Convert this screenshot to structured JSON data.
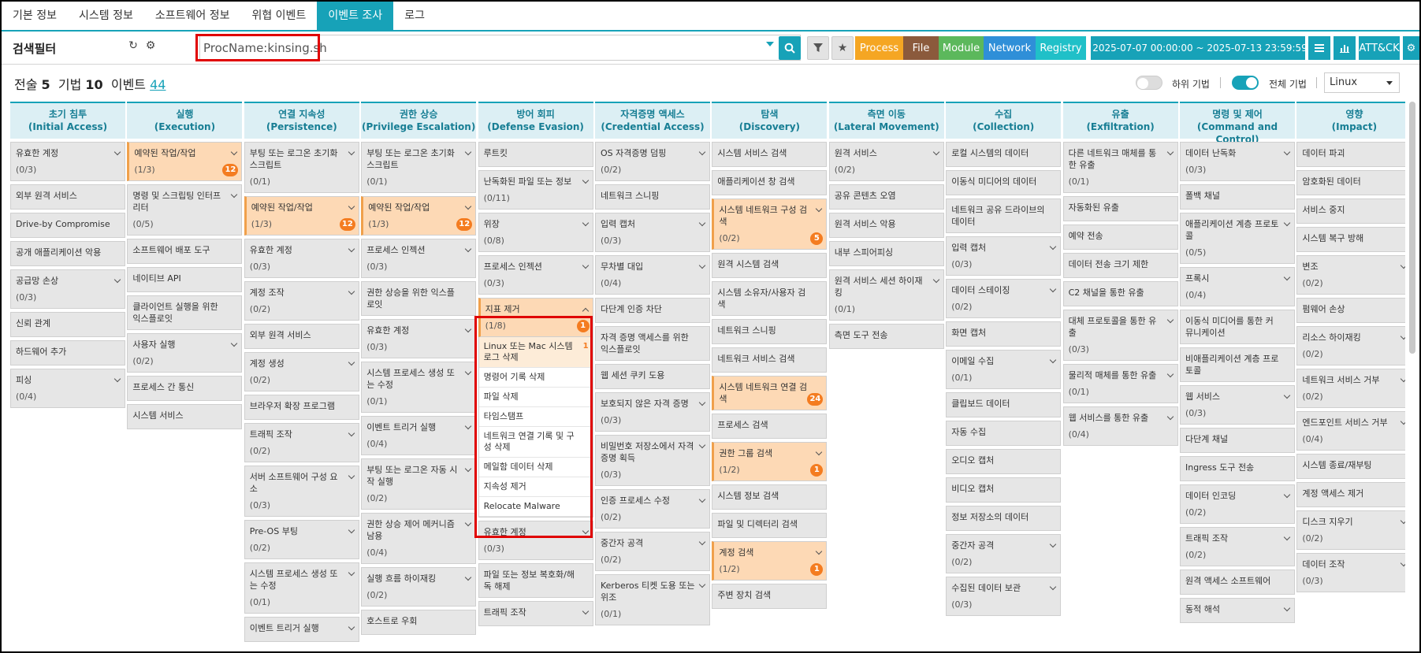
{
  "tabs": [
    {
      "label": "기본 정보",
      "active": false
    },
    {
      "label": "시스템 정보",
      "active": false
    },
    {
      "label": "소프트웨어 정보",
      "active": false
    },
    {
      "label": "위협 이벤트",
      "active": false
    },
    {
      "label": "이벤트 조사",
      "active": true
    },
    {
      "label": "로그",
      "active": false
    }
  ],
  "filter": {
    "title": "검색필터",
    "refresh_icon": "refresh-icon",
    "settings_icon": "gear-icon",
    "search_value": "ProcName:kinsing.sh",
    "search_icon": "search-icon",
    "funnel_icon": "funnel-icon",
    "star_icon": "star-icon",
    "categories": [
      {
        "label": "Process",
        "color": "#f5a623"
      },
      {
        "label": "File",
        "color": "#8b5a3c"
      },
      {
        "label": "Module",
        "color": "#5cb85c"
      },
      {
        "label": "Network",
        "color": "#2f8fd8"
      },
      {
        "label": "Registry",
        "color": "#20c0c8"
      }
    ],
    "date_range": "2025-07-07 00:00:00 ~ 2025-07-13 23:59:59",
    "calendar_icon": "calendar-icon",
    "list_icon": "list-icon",
    "chart_icon": "bar-chart-icon",
    "attck_label": "ATT&CK"
  },
  "summary": {
    "tactic_label": "전술",
    "tactic_count": "5",
    "technique_label": "기법",
    "technique_count": "10",
    "event_label": "이벤트",
    "event_count": "44"
  },
  "toggles": {
    "sub_technique_label": "하위 기법",
    "all_technique_label": "전체 기법"
  },
  "os_select": "Linux",
  "colors": {
    "accent": "#17a2b8",
    "highlight": "#fdd9b5",
    "badge": "#f47c20"
  },
  "matrix": [
    {
      "title": "초기 침투",
      "subtitle": "(Initial Access)",
      "techniques": [
        {
          "name": "유효한 계정",
          "count": "(0/3)",
          "expand": true
        },
        {
          "name": "외부 원격 서비스"
        },
        {
          "name": "Drive-by Compromise"
        },
        {
          "name": "공개 애플리케이션 악용"
        },
        {
          "name": "공급망 손상",
          "count": "(0/3)",
          "expand": true
        },
        {
          "name": "신뢰 관계"
        },
        {
          "name": "하드웨어 추가"
        },
        {
          "name": "피싱",
          "count": "(0/4)",
          "expand": true
        }
      ]
    },
    {
      "title": "실행",
      "subtitle": "(Execution)",
      "techniques": [
        {
          "name": "예약된 작업/작업",
          "count": "(1/3)",
          "expand": true,
          "hl": true,
          "badge": "12"
        },
        {
          "name": "명령 및 스크립팅 인터프리터",
          "count": "(0/5)",
          "expand": true
        },
        {
          "name": "소프트웨어 배포 도구"
        },
        {
          "name": "네이티브 API"
        },
        {
          "name": "클라이언트 실행을 위한 익스플로잇"
        },
        {
          "name": "사용자 실행",
          "count": "(0/2)",
          "expand": true
        },
        {
          "name": "프로세스 간 통신"
        },
        {
          "name": "시스템 서비스"
        }
      ]
    },
    {
      "title": "연결 지속성",
      "subtitle": "(Persistence)",
      "techniques": [
        {
          "name": "부팅 또는 로그온 초기화 스크립트",
          "count": "(0/1)",
          "expand": true
        },
        {
          "name": "예약된 작업/작업",
          "count": "(1/3)",
          "expand": true,
          "hl": true,
          "badge": "12"
        },
        {
          "name": "유효한 계정",
          "count": "(0/3)",
          "expand": true
        },
        {
          "name": "계정 조작",
          "count": "(0/2)",
          "expand": true
        },
        {
          "name": "외부 원격 서비스"
        },
        {
          "name": "계정 생성",
          "count": "(0/2)",
          "expand": true
        },
        {
          "name": "브라우저 확장 프로그램"
        },
        {
          "name": "트래픽 조작",
          "count": "(0/2)",
          "expand": true
        },
        {
          "name": "서버 소프트웨어 구성 요소",
          "count": "(0/3)",
          "expand": true
        },
        {
          "name": "Pre-OS 부팅",
          "count": "(0/2)",
          "expand": true
        },
        {
          "name": "시스템 프로세스 생성 또는 수정",
          "count": "(0/1)",
          "expand": true
        },
        {
          "name": "이벤트 트리거 실행",
          "expand": true
        }
      ]
    },
    {
      "title": "권한 상승",
      "subtitle": "(Privilege Escalation)",
      "techniques": [
        {
          "name": "부팅 또는 로그온 초기화 스크립트",
          "count": "(0/1)",
          "expand": true
        },
        {
          "name": "예약된 작업/작업",
          "count": "(1/3)",
          "expand": true,
          "hl": true,
          "badge": "12"
        },
        {
          "name": "프로세스 인젝션",
          "count": "(0/3)",
          "expand": true
        },
        {
          "name": "권한 상승을 위한 익스플로잇"
        },
        {
          "name": "유효한 계정",
          "count": "(0/3)",
          "expand": true
        },
        {
          "name": "시스템 프로세스 생성 또는 수정",
          "count": "(0/1)",
          "expand": true
        },
        {
          "name": "이벤트 트리거 실행",
          "count": "(0/4)",
          "expand": true
        },
        {
          "name": "부팅 또는 로그온 자동 시작 실행",
          "count": "(0/2)",
          "expand": true
        },
        {
          "name": "권한 상승 제어 메커니즘 남용",
          "count": "(0/4)",
          "expand": true
        },
        {
          "name": "실행 흐름 하이재킹",
          "count": "(0/2)",
          "expand": true
        },
        {
          "name": "호스트로 우회"
        }
      ]
    },
    {
      "title": "방어 회피",
      "subtitle": "(Defense Evasion)",
      "techniques": [
        {
          "name": "루트킷"
        },
        {
          "name": "난독화된 파일 또는 정보",
          "count": "(0/11)",
          "expand": true
        },
        {
          "name": "위장",
          "count": "(0/8)",
          "expand": true
        },
        {
          "name": "프로세스 인젝션",
          "count": "(0/3)",
          "expand": true
        },
        {
          "name": "지표 제거",
          "count": "(1/8)",
          "expanded": true,
          "hl": true,
          "badge": "1",
          "subs": [
            {
              "name": "Linux 또는 Mac 시스템 로그 삭제",
              "num": "1",
              "hl": true
            },
            {
              "name": "명령어 기록 삭제"
            },
            {
              "name": "파일 삭제"
            },
            {
              "name": "타임스탬프"
            },
            {
              "name": "네트워크 연결 기록 및 구성 삭제"
            },
            {
              "name": "메일함 데이터 삭제"
            },
            {
              "name": "지속성 제거"
            },
            {
              "name": "Relocate Malware"
            }
          ]
        },
        {
          "name": "유효한 계정",
          "count": "(0/3)",
          "expand": true
        },
        {
          "name": "파일 또는 정보 복호화/해독 해제"
        },
        {
          "name": "트래픽 조작",
          "expand": true
        }
      ]
    },
    {
      "title": "자격증명 액세스",
      "subtitle": "(Credential Access)",
      "techniques": [
        {
          "name": "OS 자격증명 덤핑",
          "count": "(0/2)",
          "expand": true
        },
        {
          "name": "네트워크 스니핑"
        },
        {
          "name": "입력 캡처",
          "count": "(0/3)",
          "expand": true
        },
        {
          "name": "무차별 대입",
          "count": "(0/4)",
          "expand": true
        },
        {
          "name": "다단계 인증 차단"
        },
        {
          "name": "자격 증명 액세스를 위한 익스플로잇"
        },
        {
          "name": "웹 세션 쿠키 도용"
        },
        {
          "name": "보호되지 않은 자격 증명",
          "count": "(0/3)",
          "expand": true
        },
        {
          "name": "비밀번호 저장소에서 자격 증명 획득",
          "count": "(0/3)",
          "expand": true
        },
        {
          "name": "인증 프로세스 수정",
          "count": "(0/2)",
          "expand": true
        },
        {
          "name": "중간자 공격",
          "count": "(0/2)",
          "expand": true
        },
        {
          "name": "Kerberos 티켓 도용 또는 위조",
          "count": "(0/1)",
          "expand": true
        }
      ]
    },
    {
      "title": "탐색",
      "subtitle": "(Discovery)",
      "techniques": [
        {
          "name": "시스템 서비스 검색"
        },
        {
          "name": "애플리케이션 창 검색"
        },
        {
          "name": "시스템 네트워크 구성 검색",
          "count": "(0/2)",
          "expand": true,
          "hl": true,
          "badge": "5"
        },
        {
          "name": "원격 시스템 검색"
        },
        {
          "name": "시스템 소유자/사용자 검색"
        },
        {
          "name": "네트워크 스니핑"
        },
        {
          "name": "네트워크 서비스 검색"
        },
        {
          "name": "시스템 네트워크 연결 검색",
          "hl": true,
          "badge": "24"
        },
        {
          "name": "프로세스 검색"
        },
        {
          "name": "권한 그룹 검색",
          "count": "(1/2)",
          "expand": true,
          "hl": true,
          "badge": "1"
        },
        {
          "name": "시스템 정보 검색"
        },
        {
          "name": "파일 및 디렉터리 검색"
        },
        {
          "name": "계정 검색",
          "count": "(1/2)",
          "expand": true,
          "hl": true,
          "badge": "1"
        },
        {
          "name": "주변 장치 검색"
        }
      ]
    },
    {
      "title": "측면 이동",
      "subtitle": "(Lateral Movement)",
      "techniques": [
        {
          "name": "원격 서비스",
          "count": "(0/2)",
          "expand": true
        },
        {
          "name": "공유 콘텐츠 오염"
        },
        {
          "name": "원격 서비스 악용"
        },
        {
          "name": "내부 스피어피싱"
        },
        {
          "name": "원격 서비스 세션 하이재킹",
          "count": "(0/1)",
          "expand": true
        },
        {
          "name": "측면 도구 전송"
        }
      ]
    },
    {
      "title": "수집",
      "subtitle": "(Collection)",
      "techniques": [
        {
          "name": "로컬 시스템의 데이터"
        },
        {
          "name": "이동식 미디어의 데이터"
        },
        {
          "name": "네트워크 공유 드라이브의 데이터"
        },
        {
          "name": "입력 캡처",
          "count": "(0/3)",
          "expand": true
        },
        {
          "name": "데이터 스테이징",
          "count": "(0/2)",
          "expand": true
        },
        {
          "name": "화면 캡처"
        },
        {
          "name": "이메일 수집",
          "count": "(0/1)",
          "expand": true
        },
        {
          "name": "클립보드 데이터"
        },
        {
          "name": "자동 수집"
        },
        {
          "name": "오디오 캡처"
        },
        {
          "name": "비디오 캡처"
        },
        {
          "name": "정보 저장소의 데이터"
        },
        {
          "name": "중간자 공격",
          "count": "(0/2)",
          "expand": true
        },
        {
          "name": "수집된 데이터 보관",
          "count": "(0/3)",
          "expand": true
        }
      ]
    },
    {
      "title": "유출",
      "subtitle": "(Exfiltration)",
      "techniques": [
        {
          "name": "다른 네트워크 매체를 통한 유출",
          "count": "(0/1)",
          "expand": true
        },
        {
          "name": "자동화된 유출"
        },
        {
          "name": "예약 전송"
        },
        {
          "name": "데이터 전송 크기 제한"
        },
        {
          "name": "C2 채널을 통한 유출"
        },
        {
          "name": "대체 프로토콜을 통한 유출",
          "count": "(0/3)",
          "expand": true
        },
        {
          "name": "물리적 매체를 통한 유출",
          "count": "(0/1)",
          "expand": true
        },
        {
          "name": "웹 서비스를 통한 유출",
          "count": "(0/4)",
          "expand": true
        }
      ]
    },
    {
      "title": "명령 및 제어",
      "subtitle": "(Command and Control)",
      "techniques": [
        {
          "name": "데이터 난독화",
          "count": "(0/3)",
          "expand": true
        },
        {
          "name": "폴백 채널"
        },
        {
          "name": "애플리케이션 계층 프로토콜",
          "count": "(0/5)",
          "expand": true
        },
        {
          "name": "프록시",
          "count": "(0/4)",
          "expand": true
        },
        {
          "name": "이동식 미디어를 통한 커뮤니케이션"
        },
        {
          "name": "비애플리케이션 계층 프로토콜"
        },
        {
          "name": "웹 서비스",
          "count": "(0/3)",
          "expand": true
        },
        {
          "name": "다단계 채널"
        },
        {
          "name": "Ingress 도구 전송"
        },
        {
          "name": "데이터 인코딩",
          "count": "(0/2)",
          "expand": true
        },
        {
          "name": "트래픽 조작",
          "count": "(0/2)",
          "expand": true
        },
        {
          "name": "원격 액세스 소프트웨어"
        },
        {
          "name": "동적 해석",
          "expand": true
        }
      ]
    },
    {
      "title": "영향",
      "subtitle": "(Impact)",
      "techniques": [
        {
          "name": "데이터 파괴"
        },
        {
          "name": "암호화된 데이터"
        },
        {
          "name": "서비스 중지"
        },
        {
          "name": "시스템 복구 방해"
        },
        {
          "name": "변조",
          "count": "(0/2)",
          "expand": true
        },
        {
          "name": "펌웨어 손상"
        },
        {
          "name": "리소스 하이재킹",
          "count": "(0/2)",
          "expand": true
        },
        {
          "name": "네트워크 서비스 거부",
          "count": "(0/2)",
          "expand": true
        },
        {
          "name": "엔드포인트 서비스 거부",
          "count": "(0/4)",
          "expand": true
        },
        {
          "name": "시스템 종료/재부팅"
        },
        {
          "name": "계정 액세스 제거"
        },
        {
          "name": "디스크 지우기",
          "count": "(0/2)",
          "expand": true
        },
        {
          "name": "데이터 조작",
          "count": "(0/3)",
          "expand": true
        }
      ]
    }
  ]
}
